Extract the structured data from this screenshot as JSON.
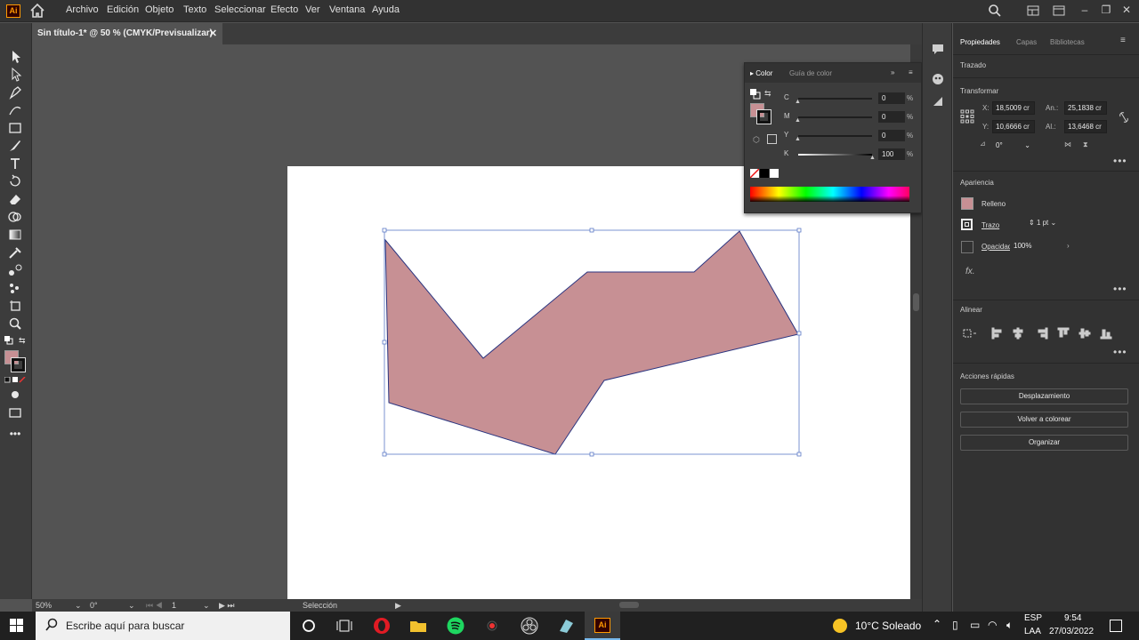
{
  "app": {
    "logo": "Ai",
    "menu": [
      "Archivo",
      "Edición",
      "Objeto",
      "Texto",
      "Seleccionar",
      "Efecto",
      "Ver",
      "Ventana",
      "Ayuda"
    ]
  },
  "document": {
    "tab_title": "Sin título-1* @ 50 % (CMYK/Previsualizar)",
    "close_glyph": "✕"
  },
  "status": {
    "zoom": "50%",
    "rotation": "0°",
    "artboard_number": "1",
    "tool_name": "Selección"
  },
  "color_panel": {
    "tabs": [
      "Color",
      "Guía de color"
    ],
    "channels": [
      {
        "label": "C",
        "value": "0"
      },
      {
        "label": "M",
        "value": "0"
      },
      {
        "label": "Y",
        "value": "0"
      },
      {
        "label": "K",
        "value": "100"
      }
    ],
    "unit": "%"
  },
  "properties": {
    "tabs": [
      "Propiedades",
      "Capas",
      "Bibliotecas"
    ],
    "selection_type": "Trazado",
    "transform": {
      "title": "Transformar",
      "x_label": "X:",
      "x_value": "18,5009 cr",
      "y_label": "Y:",
      "y_value": "10,6666 cr",
      "w_label": "An.:",
      "w_value": "25,1838 cr",
      "h_label": "Al.:",
      "h_value": "13,6468 cr",
      "angle_value": "0°"
    },
    "appearance": {
      "title": "Apariencia",
      "fill_label": "Relleno",
      "stroke_label": "Trazo",
      "stroke_weight": "1 pt",
      "opacity_label": "Opacidad",
      "opacity_value": "100%",
      "fx": "fx."
    },
    "align": {
      "title": "Alinear"
    },
    "quick_actions": {
      "title": "Acciones rápidas",
      "buttons": [
        "Desplazamiento",
        "Volver a colorear",
        "Organizar"
      ]
    }
  },
  "taskbar": {
    "search_placeholder": "Escribe aquí para buscar",
    "weather": "10°C Soleado",
    "lang_top": "ESP",
    "lang_bottom": "LAA",
    "time": "9:54",
    "date": "27/03/2022"
  },
  "colors": {
    "shape_fill": "#c79094",
    "shape_stroke": "#2b3580",
    "selection": "#5b79c6",
    "accent": "#ff9a00"
  }
}
